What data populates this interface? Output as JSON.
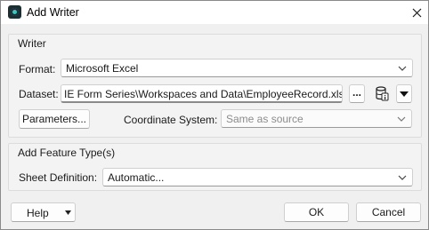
{
  "window": {
    "title": "Add Writer",
    "icon": "fme-app-icon",
    "close_icon": "close-icon"
  },
  "writer_group": {
    "title": "Writer",
    "format_label": "Format:",
    "format_value": "Microsoft Excel",
    "dataset_label": "Dataset:",
    "dataset_value": "IE Form Series\\Workspaces and Data\\EmployeeRecord.xlsx\"",
    "browse_button_label": "...",
    "parameters_button_label": "Parameters...",
    "coordinate_system_label": "Coordinate System:",
    "coordinate_system_value": "Same as source"
  },
  "feature_group": {
    "title": "Add Feature Type(s)",
    "sheet_definition_label": "Sheet Definition:",
    "sheet_definition_value": "Automatic..."
  },
  "footer": {
    "help_label": "Help",
    "ok_label": "OK",
    "cancel_label": "Cancel"
  }
}
